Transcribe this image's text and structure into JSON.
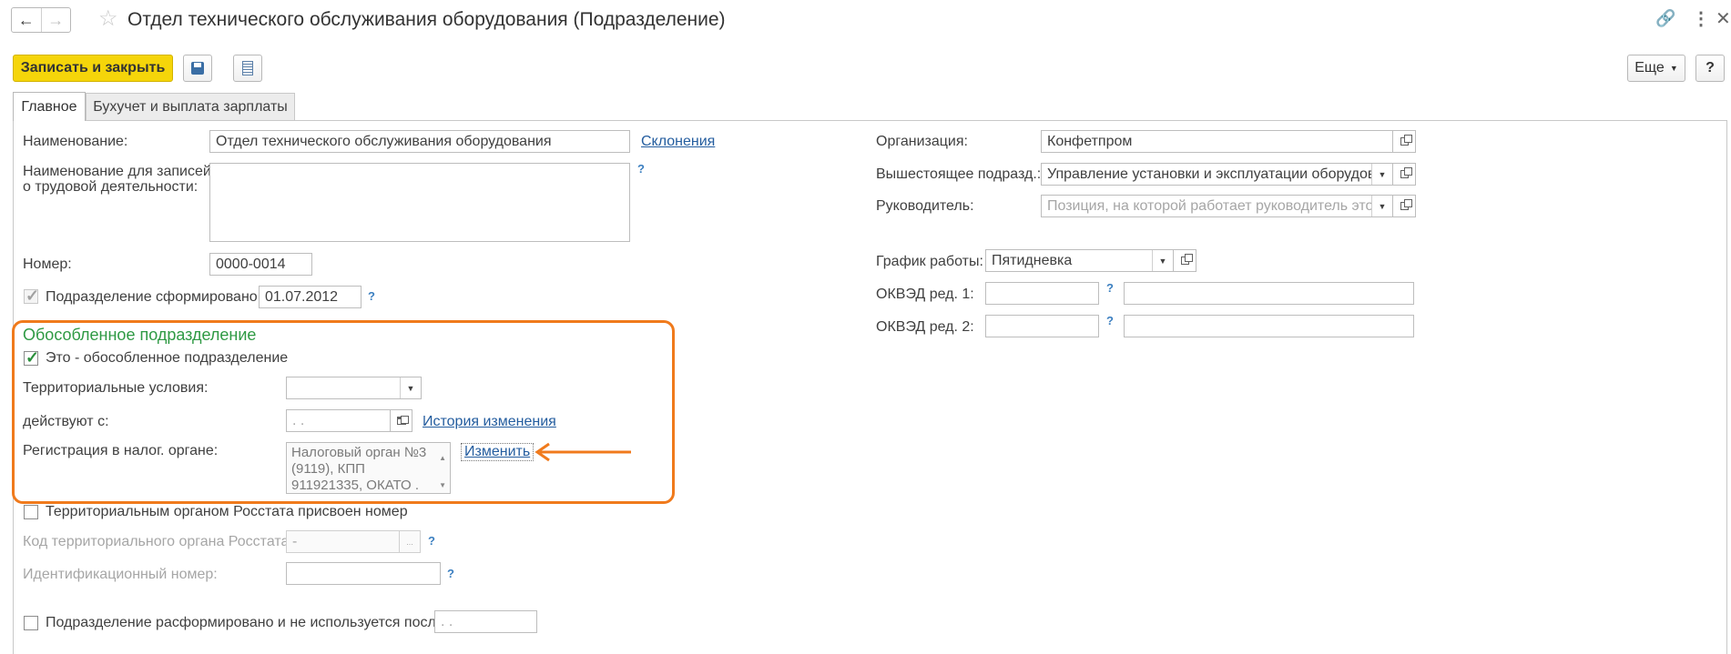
{
  "window": {
    "title": "Отдел технического обслуживания оборудования (Подразделение)"
  },
  "toolbar": {
    "save_close_label": "Записать и закрыть",
    "more_label": "Еще",
    "help_label": "?"
  },
  "tabs": [
    {
      "label": "Главное",
      "active": true
    },
    {
      "label": "Бухучет и выплата зарплаты",
      "active": false
    }
  ],
  "left": {
    "name_label": "Наименование:",
    "name_value": "Отдел технического обслуживания оборудования",
    "declensions_link": "Склонения",
    "labor_name_label_1": "Наименование для записей",
    "labor_name_label_2": "о трудовой деятельности:",
    "labor_name_value": "",
    "number_label": "Номер:",
    "number_value": "0000-0014",
    "formed_label": "Подразделение сформировано",
    "formed_checked": true,
    "formed_date": "01.07.2012"
  },
  "separate": {
    "title": "Обособленное подразделение",
    "is_separate_label": "Это - обособленное подразделение",
    "is_separate_checked": true,
    "territorial_label": "Территориальные условия:",
    "territorial_value": "",
    "valid_from_label": "действуют с:",
    "valid_from_value": " .  .",
    "history_link": "История изменения",
    "tax_label": "Регистрация в налог. органе:",
    "tax_value_lines": [
      "Налоговый орган №3",
      "(9119), КПП",
      "911921335, ОКАТО ."
    ],
    "change_link": "Изменить"
  },
  "rosstat": {
    "assigned_label": "Территориальным органом Росстата присвоен номер",
    "assigned_checked": false,
    "code_label": "Код территориального органа Росстата:",
    "code_value": " -",
    "id_label": "Идентификационный номер:",
    "id_value": ""
  },
  "disbanded": {
    "label": "Подразделение расформировано и не используется после",
    "checked": false,
    "date_value": " .  ."
  },
  "right": {
    "org_label": "Организация:",
    "org_value": "Конфетпром",
    "parent_label": "Вышестоящее подразд.:",
    "parent_value": "Управление установки и эксплуатации оборудования",
    "head_label": "Руководитель:",
    "head_placeholder": "Позиция, на которой работает руководитель это...",
    "schedule_label": "График работы:",
    "schedule_value": "Пятидневка",
    "okved1_label": "ОКВЭД ред. 1:",
    "okved1_code": "",
    "okved1_name": "",
    "okved2_label": "ОКВЭД ред. 2:",
    "okved2_code": "",
    "okved2_name": ""
  },
  "colors": {
    "accent_yellow": "#f5d50a",
    "highlight_orange": "#f07a1c",
    "group_title_green": "#2f9a44",
    "link_blue": "#245d9f"
  }
}
